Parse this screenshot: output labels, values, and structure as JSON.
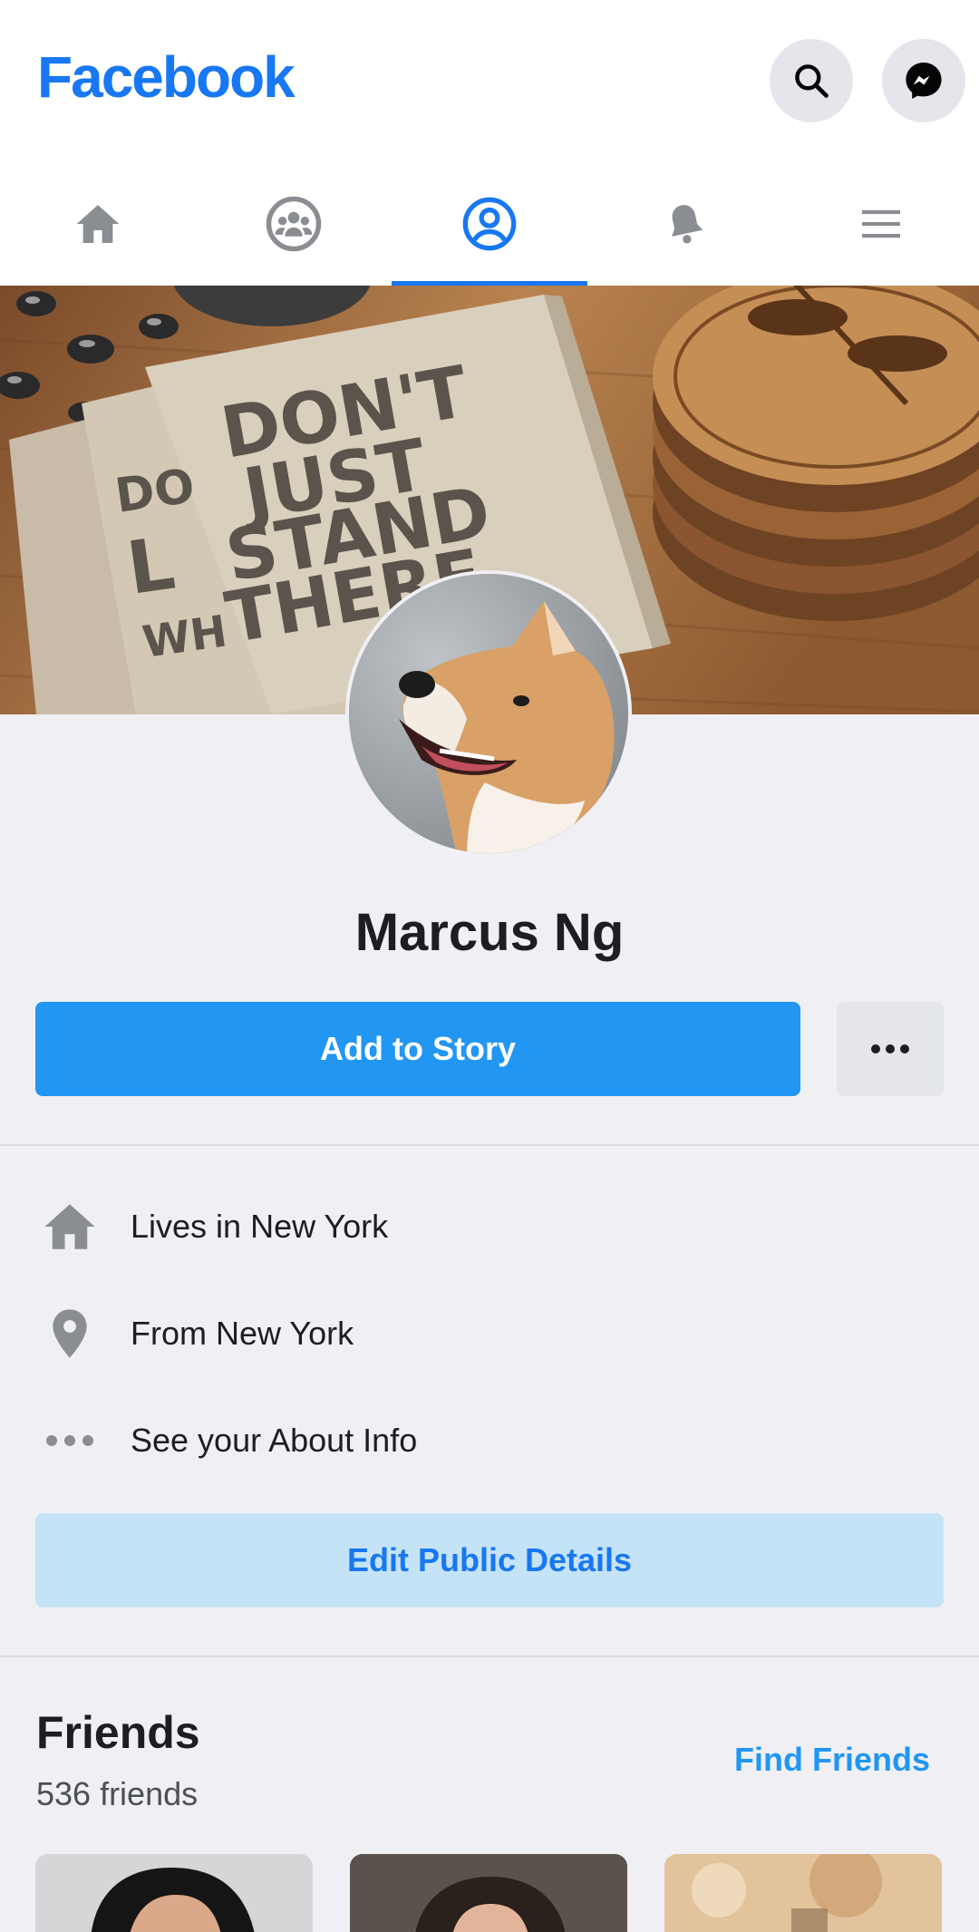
{
  "header": {
    "logo": "Facebook",
    "search_icon": "search-icon",
    "messenger_icon": "messenger-icon",
    "brand_color": "#1877f2"
  },
  "tabs": [
    {
      "icon": "home-icon"
    },
    {
      "icon": "groups-icon"
    },
    {
      "icon": "profile-icon",
      "active": true
    },
    {
      "icon": "bell-icon"
    },
    {
      "icon": "menu-icon"
    }
  ],
  "cover": {
    "text_lines": [
      "DON'T",
      "JUST",
      "STAND",
      "THERE"
    ],
    "side_text_lines": [
      "DO",
      "L",
      "WH"
    ]
  },
  "profile": {
    "name": "Marcus Ng",
    "add_to_story_label": "Add to Story",
    "more_icon": "more-dots-icon"
  },
  "about": {
    "items": [
      {
        "icon": "home-icon",
        "text": "Lives in New York"
      },
      {
        "icon": "location-pin-icon",
        "text": "From New York"
      },
      {
        "icon": "more-dots-icon",
        "text": "See your About Info"
      }
    ],
    "edit_label": "Edit Public Details"
  },
  "friends": {
    "title": "Friends",
    "count": "536 friends",
    "find_label": "Find Friends"
  }
}
